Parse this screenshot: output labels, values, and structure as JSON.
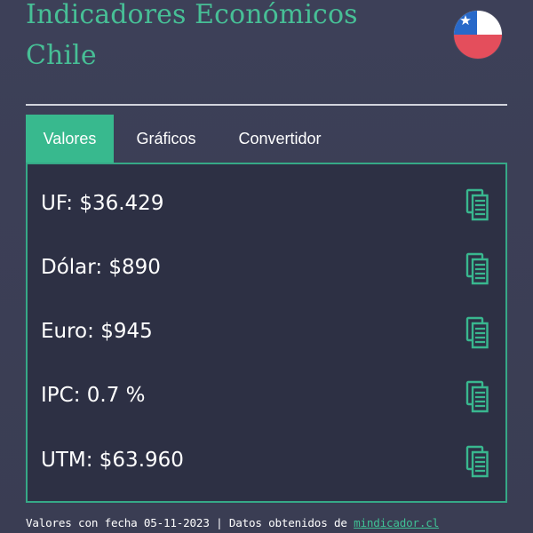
{
  "app": {
    "title": "Indicadores Económicos Chile",
    "flag_icon": "chile-flag-icon",
    "colors": {
      "background": "#3c3f55",
      "accent": "#38b98e",
      "title": "#47bf96",
      "panel": "#2d3044",
      "text": "#ffffff"
    }
  },
  "tabs": [
    {
      "label": "Valores",
      "active": true
    },
    {
      "label": "Gráficos",
      "active": false
    },
    {
      "label": "Convertidor",
      "active": false
    }
  ],
  "indicators": [
    {
      "label": "UF: $36.429",
      "icon": "copy-icon"
    },
    {
      "label": "Dólar: $890",
      "icon": "copy-icon"
    },
    {
      "label": "Euro: $945",
      "icon": "copy-icon"
    },
    {
      "label": "IPC: 0.7 %",
      "icon": "copy-icon"
    },
    {
      "label": "UTM: $63.960",
      "icon": "copy-icon"
    }
  ],
  "footer": {
    "prefix": "Valores con fecha 05-11-2023 | Datos obtenidos de ",
    "link_text": "mindicador.cl"
  }
}
